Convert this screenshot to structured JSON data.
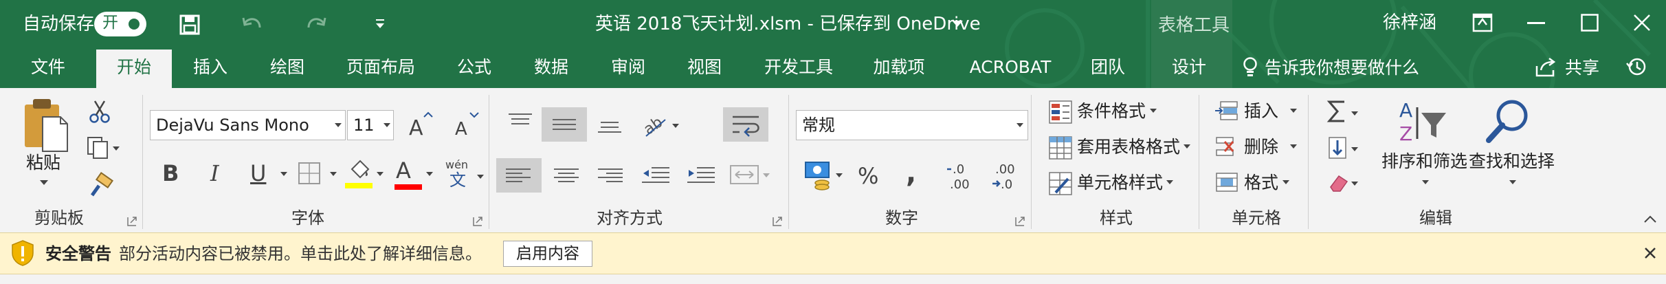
{
  "titlebar": {
    "autosave_label": "自动保存",
    "autosave_state": "开",
    "document_title": "英语 2018飞天计划.xlsm  -  已保存到 OneDrive",
    "context_tool": "表格工具",
    "user_name": "徐梓涵"
  },
  "tabs": [
    {
      "label": "文件"
    },
    {
      "label": "开始"
    },
    {
      "label": "插入"
    },
    {
      "label": "绘图"
    },
    {
      "label": "页面布局"
    },
    {
      "label": "公式"
    },
    {
      "label": "数据"
    },
    {
      "label": "审阅"
    },
    {
      "label": "视图"
    },
    {
      "label": "开发工具"
    },
    {
      "label": "加载项"
    },
    {
      "label": "ACROBAT"
    },
    {
      "label": "团队"
    },
    {
      "label": "设计"
    }
  ],
  "tellme": "告诉我你想要做什么",
  "share_label": "共享",
  "clipboard": {
    "paste_label": "粘贴",
    "group_label": "剪贴板"
  },
  "font": {
    "name": "DejaVu Sans Mono",
    "size": "11",
    "phonetic": "wén",
    "phonetic_char": "文",
    "group_label": "字体",
    "bold": "B",
    "italic": "I",
    "underline": "U",
    "font_color_letter": "A",
    "highlight_color": "#ffff00",
    "font_color": "#ff0000"
  },
  "alignment": {
    "group_label": "对齐方式"
  },
  "number": {
    "format": "常规",
    "percent": "%",
    "comma": ",",
    "inc_decimal": ".0\n.00",
    "group_label": "数字"
  },
  "styles": {
    "conditional": "条件格式",
    "table": "套用表格格式",
    "cell": "单元格样式",
    "group_label": "样式"
  },
  "cells": {
    "insert": "插入",
    "delete": "删除",
    "format": "格式",
    "group_label": "单元格"
  },
  "editing": {
    "sort_filter": "排序和筛选",
    "find_select": "查找和选择",
    "group_label": "编辑"
  },
  "warning": {
    "title": "安全警告",
    "message": "部分活动内容已被禁用。单击此处了解详细信息。",
    "button": "启用内容"
  },
  "colors": {
    "accent": "#217346",
    "warning_bg": "#fff4ce"
  }
}
